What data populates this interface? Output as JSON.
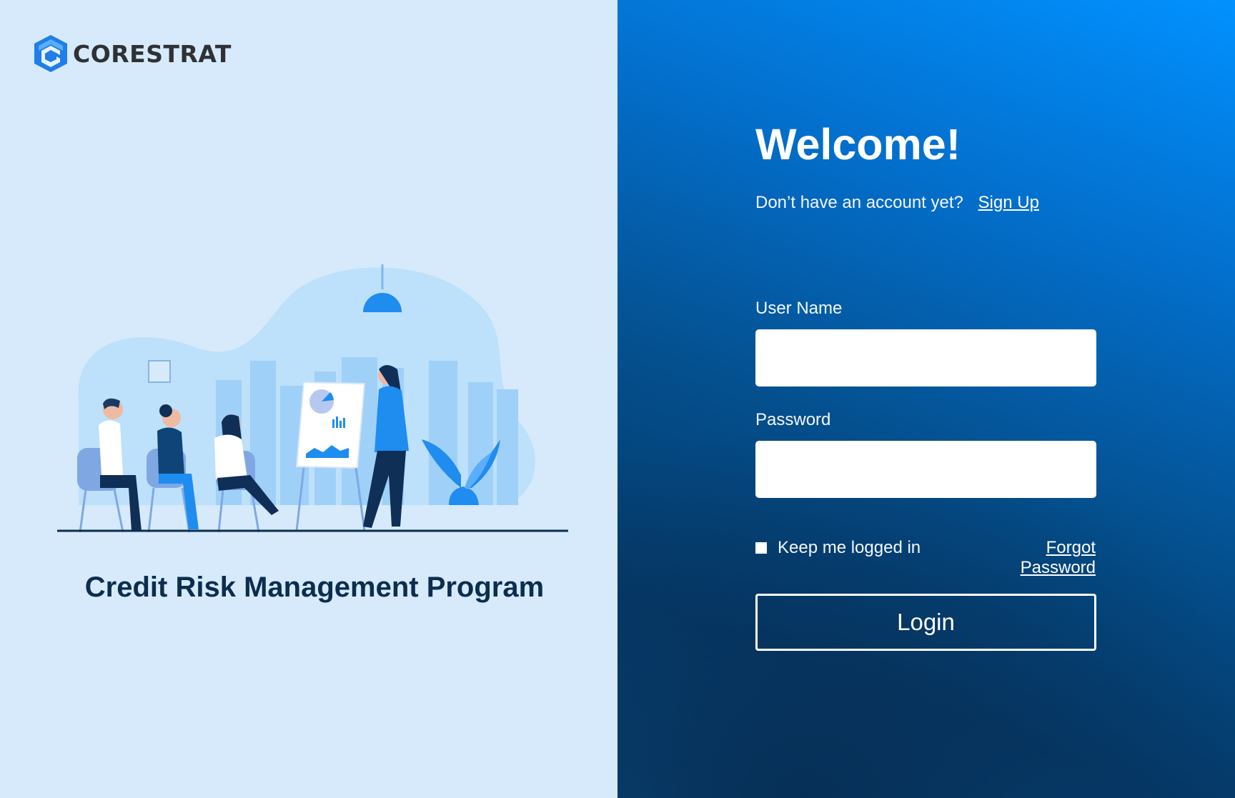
{
  "brand": {
    "name": "CORESTRAT"
  },
  "program": {
    "title": "Credit Risk Management Program"
  },
  "login": {
    "title": "Welcome!",
    "signup_prompt": "Don’t have an account yet?",
    "signup_link": "Sign Up",
    "username_label": "User Name",
    "username_value": "",
    "password_label": "Password",
    "password_value": "",
    "keep_logged_in_label": "Keep me logged in",
    "keep_logged_in_checked": false,
    "forgot_password_label": "Forgot Password",
    "login_button_label": "Login"
  },
  "colors": {
    "left_background": "#d6eafb",
    "accent_blue": "#0291ff",
    "dark_navy": "#0c2d4f"
  }
}
